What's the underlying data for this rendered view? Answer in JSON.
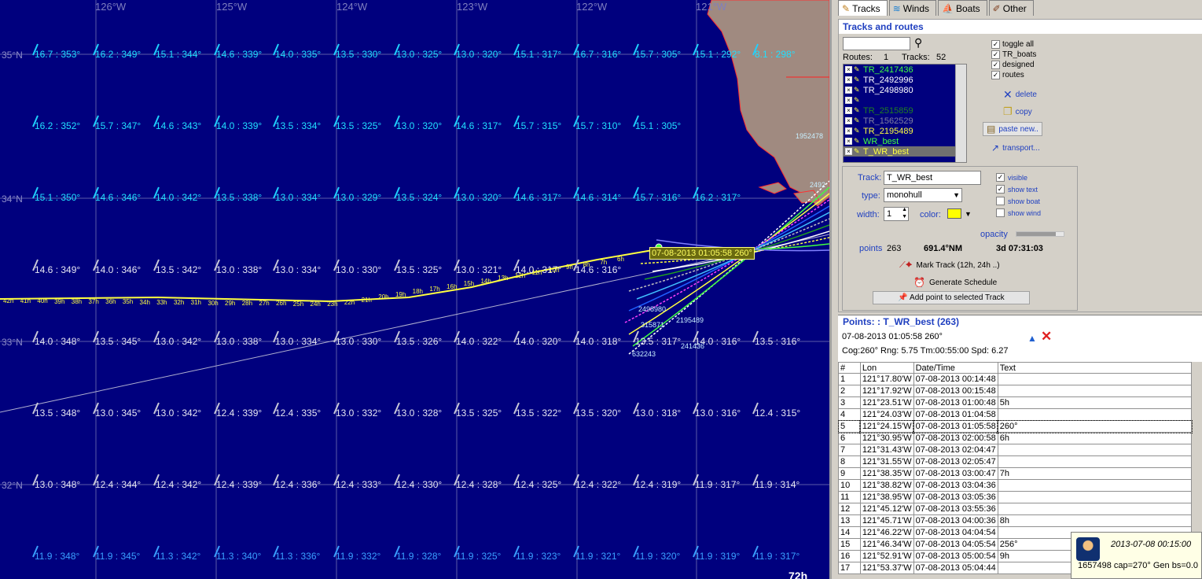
{
  "map": {
    "lon_labels": [
      "126°W",
      "125°W",
      "124°W",
      "123°W",
      "122°W",
      "121°W"
    ],
    "lat_labels": [
      "35°N",
      "34°N",
      "33°N",
      "32°N"
    ],
    "wind_rows": [
      {
        "cls": "cyan",
        "items": [
          "16.7 : 353°",
          "16.2 : 349°",
          "15.1 : 344°",
          "14.6 : 339°",
          "14.0 : 335°",
          "13.5 : 330°",
          "13.0 : 325°",
          "13.0 : 320°",
          "15.1 : 317°",
          "16.7 : 316°",
          "15.7 : 305°",
          "15.1 : 292°",
          "8.1 : 298°"
        ]
      },
      {
        "cls": "cyan",
        "items": [
          "16.2 : 352°",
          "15.7 : 347°",
          "14.6 : 343°",
          "14.0 : 339°",
          "13.5 : 334°",
          "13.5 : 325°",
          "13.0 : 320°",
          "14.6 : 317°",
          "15.7 : 315°",
          "15.7 : 310°",
          "15.1 : 305°"
        ]
      },
      {
        "cls": "cyan",
        "items": [
          "15.1 : 350°",
          "14.6 : 346°",
          "14.0 : 342°",
          "13.5 : 338°",
          "13.0 : 334°",
          "13.0 : 329°",
          "13.5 : 324°",
          "13.0 : 320°",
          "14.6 : 317°",
          "14.6 : 314°",
          "15.7 : 316°",
          "16.2 : 317°"
        ]
      },
      {
        "cls": "white",
        "items": [
          "14.6 : 349°",
          "14.0 : 346°",
          "13.5 : 342°",
          "13.0 : 338°",
          "13.0 : 334°",
          "13.0 : 330°",
          "13.5 : 325°",
          "13.0 : 321°",
          "14.0 : 317°",
          "14.6 : 316°"
        ]
      },
      {
        "cls": "white",
        "items": [
          "14.0 : 348°",
          "13.5 : 345°",
          "13.0 : 342°",
          "13.0 : 338°",
          "13.0 : 334°",
          "13.0 : 330°",
          "13.5 : 326°",
          "14.0 : 322°",
          "14.0 : 320°",
          "14.0 : 318°",
          "13.5 : 317°",
          "14.0 : 316°",
          "13.5 : 316°"
        ]
      },
      {
        "cls": "white",
        "items": [
          "13.5 : 348°",
          "13.0 : 345°",
          "13.0 : 342°",
          "12.4 : 339°",
          "12.4 : 335°",
          "13.0 : 332°",
          "13.0 : 328°",
          "13.5 : 325°",
          "13.5 : 322°",
          "13.5 : 320°",
          "13.0 : 318°",
          "13.0 : 316°",
          "12.4 : 315°"
        ]
      },
      {
        "cls": "white",
        "items": [
          "13.0 : 348°",
          "12.4 : 344°",
          "12.4 : 342°",
          "12.4 : 339°",
          "12.4 : 336°",
          "12.4 : 333°",
          "12.4 : 330°",
          "12.4 : 328°",
          "12.4 : 325°",
          "12.4 : 322°",
          "12.4 : 319°",
          "11.9 : 317°",
          "11.9 : 314°"
        ]
      },
      {
        "cls": "blue",
        "items": [
          "11.9 : 348°",
          "11.9 : 345°",
          "11.3 : 342°",
          "11.3 : 340°",
          "11.3 : 336°",
          "11.9 : 332°",
          "11.9 : 328°",
          "11.9 : 325°",
          "11.9 : 323°",
          "11.9 : 321°",
          "11.9 : 320°",
          "11.9 : 319°",
          "11.9 : 317°"
        ]
      }
    ],
    "track_labels": [
      "42h",
      "41h",
      "40h",
      "39h",
      "38h",
      "37h",
      "36h",
      "35h",
      "34h",
      "33h",
      "32h",
      "31h",
      "30h",
      "29h",
      "28h",
      "27h",
      "26h",
      "25h",
      "24h",
      "23h",
      "22h",
      "21h",
      "20h",
      "19h",
      "18h",
      "17h",
      "16h",
      "15h",
      "14h",
      "13h",
      "12h",
      "11h",
      "10h",
      "9h",
      "8h",
      "7h",
      "6h"
    ],
    "tooltip": "07-08-2013 01:05:58 260°",
    "boat_labels": [
      "632243",
      "241436",
      "2195489",
      "315871",
      "2498980",
      "1952478",
      "2492"
    ],
    "timer": "72h"
  },
  "panel": {
    "tabs": [
      {
        "label": "Tracks",
        "icon": "✎"
      },
      {
        "label": "Winds",
        "icon": "≋"
      },
      {
        "label": "Boats",
        "icon": "⛵"
      },
      {
        "label": "Other",
        "icon": "✐"
      }
    ],
    "tracks_header": "Tracks and routes",
    "search_value": "",
    "routes_label": "Routes:",
    "routes_count": "1",
    "tracks_label": "Tracks:",
    "tracks_count": "52",
    "track_list": [
      {
        "name": "TR_2417436",
        "color": "#40ff40"
      },
      {
        "name": "TR_2492996",
        "color": "#ffffff"
      },
      {
        "name": "TR_2498980",
        "color": "#ffffff"
      },
      {
        "name": "",
        "color": "#2040ff"
      },
      {
        "name": "TR_2515859",
        "color": "#208020"
      },
      {
        "name": "TR_1562529",
        "color": "#8080a0"
      },
      {
        "name": "TR_2195489",
        "color": "#ffff40"
      },
      {
        "name": "WR_best",
        "color": "#40ff40"
      },
      {
        "name": "T_WR_best",
        "color": "#ffff40",
        "selected": true
      }
    ],
    "toggles": [
      {
        "label": "toggle all",
        "checked": "✓"
      },
      {
        "label": "TR_boats",
        "checked": "✓"
      },
      {
        "label": "designed",
        "checked": "✓"
      },
      {
        "label": "routes",
        "checked": "✓"
      }
    ],
    "actions": {
      "delete": "delete",
      "copy": "copy",
      "paste": "paste new..",
      "transport": "transport..."
    },
    "props": {
      "track_label": "Track:",
      "track_value": "T_WR_best",
      "type_label": "type:",
      "type_value": "monohull",
      "width_label": "width:",
      "width_value": "1",
      "color_label": "color:",
      "color_value": "#ffff00",
      "visible": "visible",
      "show_text": "show text",
      "show_boat": "show boat",
      "show_wind": "show wind",
      "visible_checked": "✓",
      "show_text_checked": "✓",
      "show_boat_checked": "",
      "show_wind_checked": "",
      "opacity_label": "opacity",
      "opacity_value": 0.83,
      "points_label": "points",
      "points_value": "263",
      "distance": "691.4°NM",
      "duration": "3d 07:31:03",
      "mark_track": "Mark Track (12h, 24h ..)",
      "gen_schedule": "Generate Schedule",
      "add_point": "Add point to selected Track"
    },
    "points_header": "Points: : T_WR_best (263)",
    "points_info1": "07-08-2013 01:05:58 260°",
    "points_info2": "Cog:260° Rng:  5.75 Tm:00:55:00 Spd:  6.27",
    "points_columns": [
      "#",
      "Lon",
      "Date/Time",
      "Text"
    ],
    "points_rows": [
      [
        "1",
        "121°17.80'W",
        "07-08-2013 00:14:48",
        ""
      ],
      [
        "2",
        "121°17.92'W",
        "07-08-2013 00:15:48",
        ""
      ],
      [
        "3",
        "121°23.51'W",
        "07-08-2013 01:00:48",
        "5h"
      ],
      [
        "4",
        "121°24.03'W",
        "07-08-2013 01:04:58",
        ""
      ],
      [
        "5",
        "121°24.15'W",
        "07-08-2013 01:05:58",
        "260°"
      ],
      [
        "6",
        "121°30.95'W",
        "07-08-2013 02:00:58",
        "6h"
      ],
      [
        "7",
        "121°31.43'W",
        "07-08-2013 02:04:47",
        ""
      ],
      [
        "8",
        "121°31.55'W",
        "07-08-2013 02:05:47",
        ""
      ],
      [
        "9",
        "121°38.35'W",
        "07-08-2013 03:00:47",
        "7h"
      ],
      [
        "10",
        "121°38.82'W",
        "07-08-2013 03:04:36",
        ""
      ],
      [
        "11",
        "121°38.95'W",
        "07-08-2013 03:05:36",
        ""
      ],
      [
        "12",
        "121°45.12'W",
        "07-08-2013 03:55:36",
        ""
      ],
      [
        "13",
        "121°45.71'W",
        "07-08-2013 04:00:36",
        "8h"
      ],
      [
        "14",
        "121°46.22'W",
        "07-08-2013 04:04:54",
        ""
      ],
      [
        "15",
        "121°46.34'W",
        "07-08-2013 04:05:54",
        "256°"
      ],
      [
        "16",
        "121°52.91'W",
        "07-08-2013 05:00:54",
        "9h"
      ],
      [
        "17",
        "121°53.37'W",
        "07-08-2013 05:04:44",
        ""
      ]
    ],
    "notify": {
      "time": "2013-07-08 00:15:00",
      "message": "1657498 cap=270° Gen bs=0.0"
    }
  }
}
